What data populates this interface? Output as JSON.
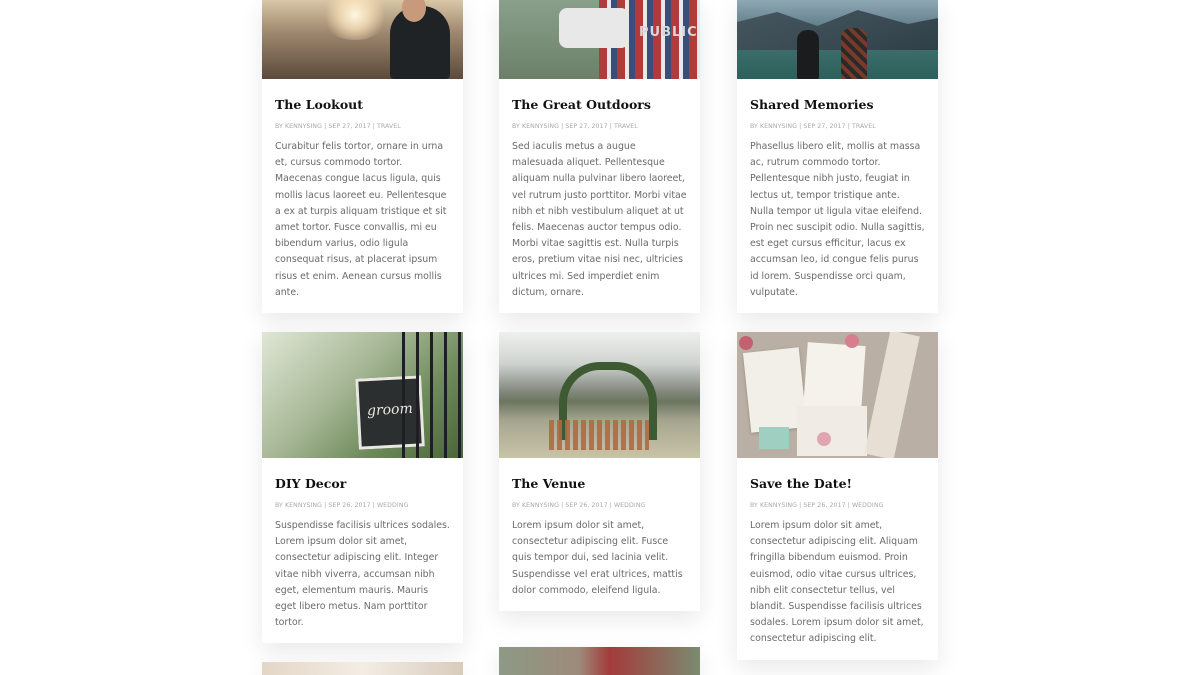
{
  "posts": [
    {
      "title": "The Lookout",
      "meta": "BY KENNYSING | SEP 27, 2017 | TRAVEL",
      "excerpt": "Curabitur felis tortor, ornare in urna et, cursus commodo tortor. Maecenas congue lacus ligula, quis mollis lacus laoreet eu. Pellentesque a ex at turpis aliquam tristique et sit amet tortor. Fusce convallis, mi eu bibendum varius, odio ligula consequat risus, at placerat ipsum risus et enim. Aenean cursus mollis ante."
    },
    {
      "title": "The Great Outdoors",
      "meta": "BY KENNYSING | SEP 27, 2017 | TRAVEL",
      "excerpt": "Sed iaculis metus a augue malesuada aliquet. Pellentesque aliquam nulla pulvinar libero laoreet, vel rutrum justo porttitor. Morbi vitae nibh et nibh vestibulum aliquet at ut felis. Maecenas auctor tempus odio. Morbi vitae sagittis est. Nulla turpis eros, pretium vitae nisi nec, ultricies ultrices mi. Sed imperdiet enim dictum, ornare.",
      "image_text": "PUBLIC"
    },
    {
      "title": "Shared Memories",
      "meta": "BY KENNYSING | SEP 27, 2017 | TRAVEL",
      "excerpt": "Phasellus libero elit, mollis at massa ac, rutrum commodo tortor. Pellentesque nibh justo, feugiat in lectus ut, tempor tristique ante. Nulla tempor ut ligula vitae eleifend. Proin nec suscipit odio. Nulla sagittis, est eget cursus efficitur, lacus ex accumsan leo, id congue felis purus id lorem. Suspendisse orci quam, vulputate."
    },
    {
      "title": "DIY Decor",
      "meta": "BY KENNYSING | SEP 26, 2017 | WEDDING",
      "excerpt": "Suspendisse facilisis ultrices sodales. Lorem ipsum dolor sit amet, consectetur adipiscing elit. Integer vitae nibh viverra, accumsan nibh eget, elementum mauris. Mauris eget libero metus. Nam porttitor tortor.",
      "image_text": "groom"
    },
    {
      "title": "The Venue",
      "meta": "BY KENNYSING | SEP 26, 2017 | WEDDING",
      "excerpt": "Lorem ipsum dolor sit amet, consectetur adipiscing elit. Fusce quis tempor dui, sed lacinia velit. Suspendisse vel erat ultrices, mattis dolor commodo, eleifend ligula."
    },
    {
      "title": "Save the Date!",
      "meta": "BY KENNYSING | SEP 26, 2017 | WEDDING",
      "excerpt": "Lorem ipsum dolor sit amet, consectetur adipiscing elit. Aliquam fringilla bibendum euismod. Proin euismod, odio vitae cursus ultrices, nibh elit consectetur tellus, vel blandit. Suspendisse facilisis ultrices sodales. Lorem ipsum dolor sit amet, consectetur adipiscing elit."
    }
  ]
}
